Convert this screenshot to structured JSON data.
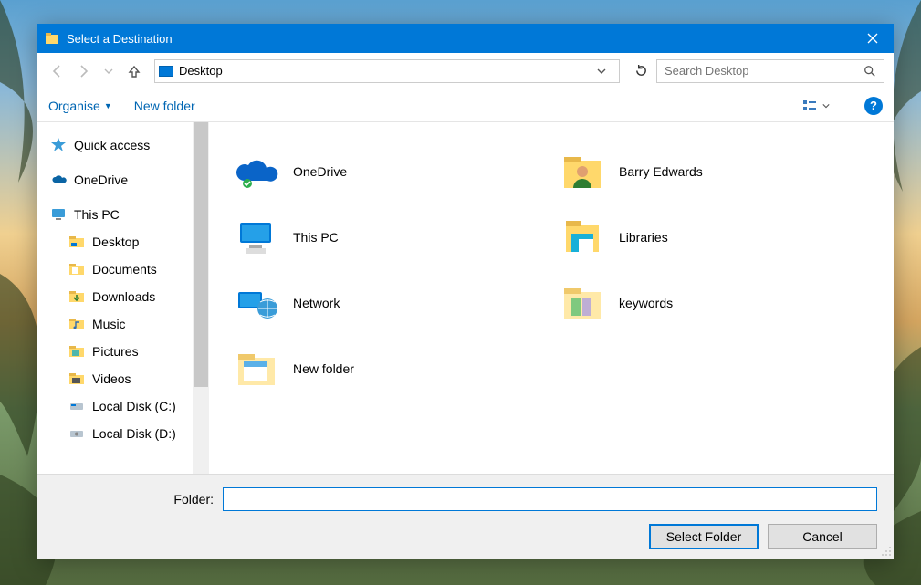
{
  "window": {
    "title": "Select a Destination"
  },
  "nav": {
    "location": "Desktop",
    "search_placeholder": "Search Desktop"
  },
  "toolbar": {
    "organise": "Organise",
    "new_folder": "New folder"
  },
  "tree": {
    "quick_access": "Quick access",
    "onedrive": "OneDrive",
    "this_pc": "This PC",
    "desktop": "Desktop",
    "documents": "Documents",
    "downloads": "Downloads",
    "music": "Music",
    "pictures": "Pictures",
    "videos": "Videos",
    "local_disk_c": "Local Disk (C:)",
    "local_disk_d": "Local Disk (D:)"
  },
  "items": {
    "onedrive": "OneDrive",
    "barry": "Barry Edwards",
    "this_pc": "This PC",
    "libraries": "Libraries",
    "network": "Network",
    "keywords": "keywords",
    "new_folder": "New folder"
  },
  "footer": {
    "folder_label": "Folder:",
    "folder_value": "",
    "select": "Select Folder",
    "cancel": "Cancel"
  }
}
